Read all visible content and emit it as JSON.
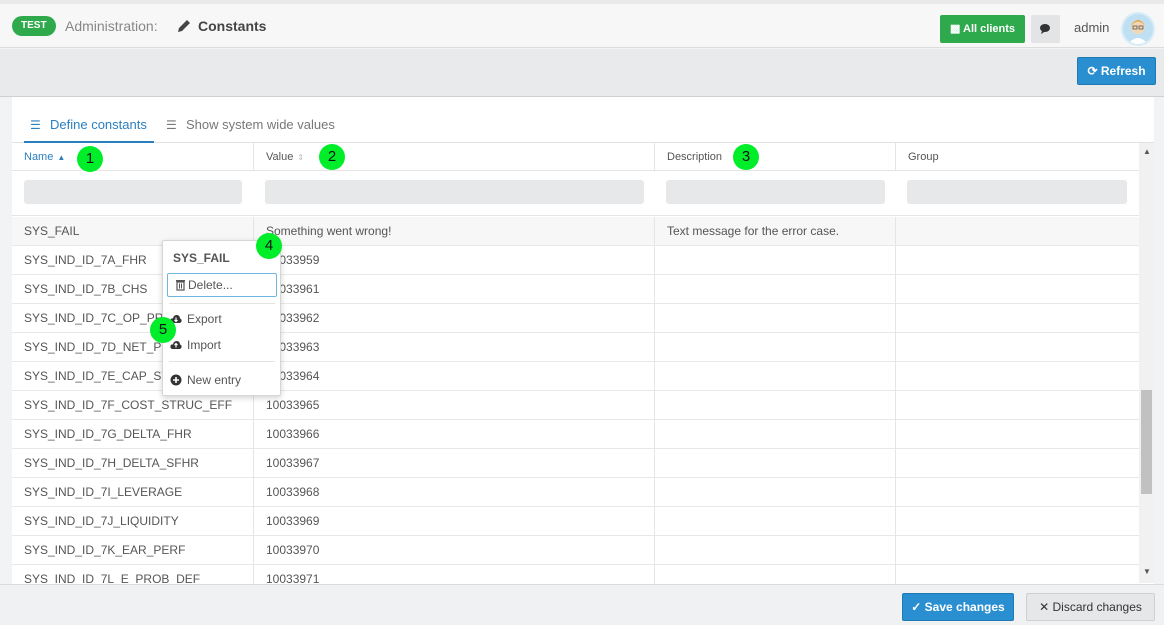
{
  "header": {
    "env_badge": "TEST",
    "crumb": "Administration:",
    "current": "Constants",
    "all_clients": "All clients",
    "username": "admin"
  },
  "toolbar": {
    "refresh": "Refresh"
  },
  "tabs": [
    {
      "label": "Define constants",
      "active": true
    },
    {
      "label": "Show system wide values",
      "active": false
    }
  ],
  "grid": {
    "columns": [
      {
        "label": "Name",
        "sorted": "asc"
      },
      {
        "label": "Value",
        "sorted": "none"
      },
      {
        "label": "Description"
      },
      {
        "label": "Group"
      }
    ],
    "rows": [
      {
        "name": "SYS_FAIL",
        "value": "Something went wrong!",
        "description": "Text message for the error case.",
        "group": ""
      },
      {
        "name": "SYS_IND_ID_7A_FHR",
        "value": "10033959",
        "description": "",
        "group": ""
      },
      {
        "name": "SYS_IND_ID_7B_CHS",
        "value": "10033961",
        "description": "",
        "group": ""
      },
      {
        "name": "SYS_IND_ID_7C_OP_PROF",
        "value": "10033962",
        "description": "",
        "group": ""
      },
      {
        "name": "SYS_IND_ID_7D_NET_PROF",
        "value": "10033963",
        "description": "",
        "group": ""
      },
      {
        "name": "SYS_IND_ID_7E_CAP_STRUC",
        "value": "10033964",
        "description": "",
        "group": ""
      },
      {
        "name": "SYS_IND_ID_7F_COST_STRUC_EFF",
        "value": "10033965",
        "description": "",
        "group": ""
      },
      {
        "name": "SYS_IND_ID_7G_DELTA_FHR",
        "value": "10033966",
        "description": "",
        "group": ""
      },
      {
        "name": "SYS_IND_ID_7H_DELTA_SFHR",
        "value": "10033967",
        "description": "",
        "group": ""
      },
      {
        "name": "SYS_IND_ID_7I_LEVERAGE",
        "value": "10033968",
        "description": "",
        "group": ""
      },
      {
        "name": "SYS_IND_ID_7J_LIQUIDITY",
        "value": "10033969",
        "description": "",
        "group": ""
      },
      {
        "name": "SYS_IND_ID_7K_EAR_PERF",
        "value": "10033970",
        "description": "",
        "group": ""
      },
      {
        "name": "SYS_IND_ID_7L_E_PROB_DEF",
        "value": "10033971",
        "description": "",
        "group": ""
      }
    ]
  },
  "context_menu": {
    "title": "SYS_FAIL",
    "delete": "Delete...",
    "export": "Export",
    "import": "Import",
    "new_entry": "New entry"
  },
  "footer": {
    "save": "Save changes",
    "discard": "Discard changes"
  },
  "callouts": [
    "1",
    "2",
    "3",
    "4",
    "5"
  ],
  "colors": {
    "accent_blue": "#2a8fd0",
    "accent_green": "#2eaa4d",
    "callout_green": "#00ee2a"
  }
}
